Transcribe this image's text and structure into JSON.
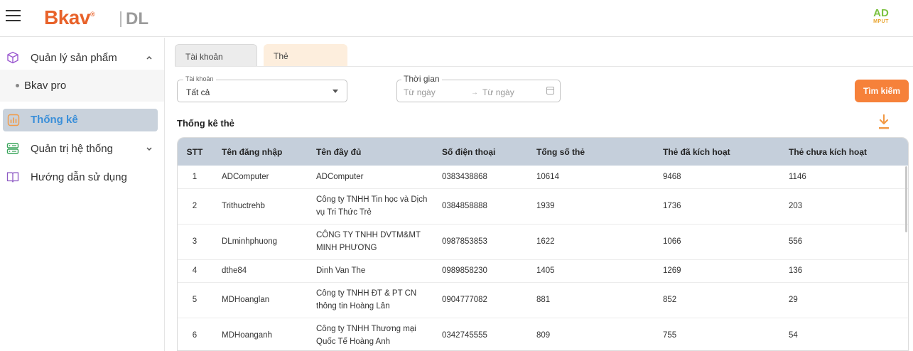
{
  "header": {
    "logo_main": "Bkav",
    "logo_sup": "®",
    "logo_sub": "DL",
    "badge_top": "AD",
    "badge_bottom": "MPUT"
  },
  "sidebar": {
    "items": [
      {
        "label": "Quản lý sản phẩm",
        "icon": "cube-icon",
        "expanded": true
      },
      {
        "label": "Bkav pro",
        "icon": "dot-icon"
      },
      {
        "label": "Thống kê",
        "icon": "chart-icon",
        "active": true
      },
      {
        "label": "Quản trị hệ thống",
        "icon": "server-icon",
        "expanded": false
      },
      {
        "label": "Hướng dẫn sử dụng",
        "icon": "book-icon"
      }
    ]
  },
  "tabs": [
    {
      "label": "Tài khoản"
    },
    {
      "label": "Thẻ",
      "active": true
    }
  ],
  "filters": {
    "account_legend": "Tài khoản",
    "account_value": "Tất cả",
    "date_legend": "Thời gian",
    "date_from_placeholder": "Từ ngày",
    "date_to_placeholder": "Từ ngày",
    "search_label": "Tìm kiếm"
  },
  "section_title": "Thống kê thẻ",
  "table": {
    "columns": [
      "STT",
      "Tên đăng nhập",
      "Tên đầy đủ",
      "Số điện thoại",
      "Tổng số thẻ",
      "Thẻ đã kích hoạt",
      "Thẻ chưa kích hoạt"
    ],
    "rows": [
      {
        "stt": "1",
        "username": "ADComputer",
        "fullname_1": "ADComputer",
        "fullname_2": "",
        "phone": "0383438868",
        "total": "10614",
        "activated": "9468",
        "not_activated": "1146"
      },
      {
        "stt": "2",
        "username": "Trithuctrehb",
        "fullname_1": "Công ty TNHH Tin học và Dịch",
        "fullname_2": "vụ Tri Thức Trẻ",
        "phone": "0384858888",
        "total": "1939",
        "activated": "1736",
        "not_activated": "203"
      },
      {
        "stt": "3",
        "username": "DLminhphuong",
        "fullname_1": "CÔNG TY TNHH DVTM&MT",
        "fullname_2": "MINH PHƯƠNG",
        "phone": "0987853853",
        "total": "1622",
        "activated": "1066",
        "not_activated": "556"
      },
      {
        "stt": "4",
        "username": "dthe84",
        "fullname_1": "Dinh Van The",
        "fullname_2": "",
        "phone": "0989858230",
        "total": "1405",
        "activated": "1269",
        "not_activated": "136"
      },
      {
        "stt": "5",
        "username": "MDHoanglan",
        "fullname_1": "Công ty TNHH ĐT & PT CN",
        "fullname_2": "thông tin Hoàng Lân",
        "phone": "0904777082",
        "total": "881",
        "activated": "852",
        "not_activated": "29"
      },
      {
        "stt": "6",
        "username": "MDHoanganh",
        "fullname_1": "Công ty TNHH Thương mại",
        "fullname_2": "Quốc Tế Hoàng Anh",
        "phone": "0342745555",
        "total": "809",
        "activated": "755",
        "not_activated": "54"
      }
    ]
  },
  "colors": {
    "brand_orange": "#e8622a",
    "accent_blue": "#3a8fd9",
    "button_orange": "#f6813a",
    "header_row": "#c5cfdb"
  }
}
